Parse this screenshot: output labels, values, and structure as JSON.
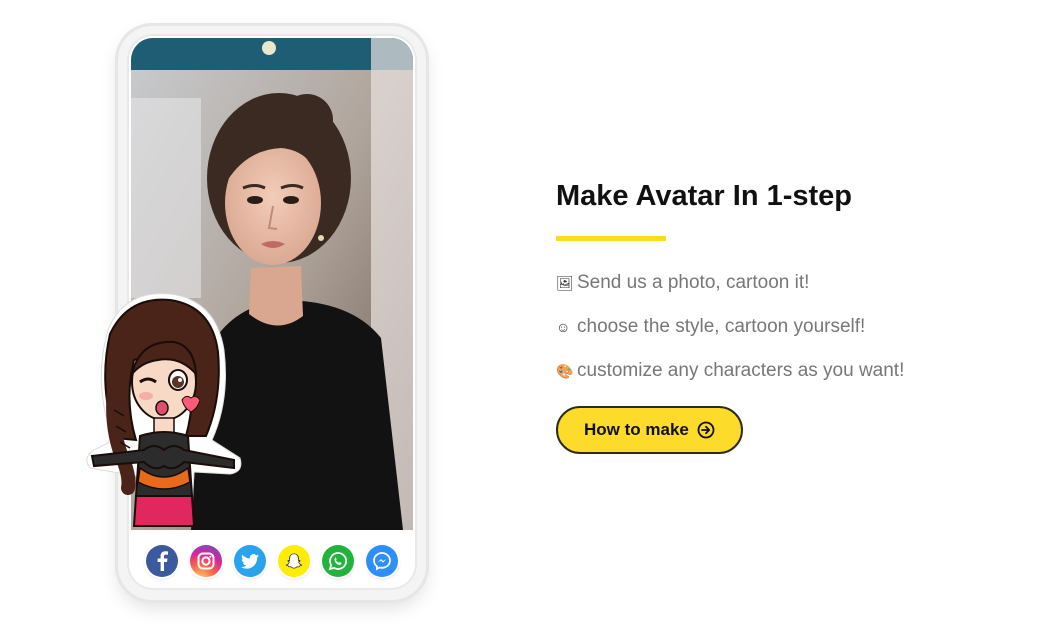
{
  "hero": {
    "title": "Make Avatar In 1-step",
    "features": [
      {
        "icon": "photos-icon",
        "glyph": "🖼",
        "text": "Send us a photo, cartoon it!"
      },
      {
        "icon": "smiley-icon",
        "glyph": "☺",
        "text": "choose the style, cartoon yourself!"
      },
      {
        "icon": "palette-icon",
        "glyph": "🎨",
        "text": "customize any characters as you want!"
      }
    ],
    "cta_label": "How to make",
    "accent_color": "#fadb1d"
  },
  "phone": {
    "share_icons": [
      "facebook-icon",
      "instagram-icon",
      "twitter-icon",
      "snapchat-icon",
      "whatsapp-icon",
      "messenger-icon"
    ]
  }
}
